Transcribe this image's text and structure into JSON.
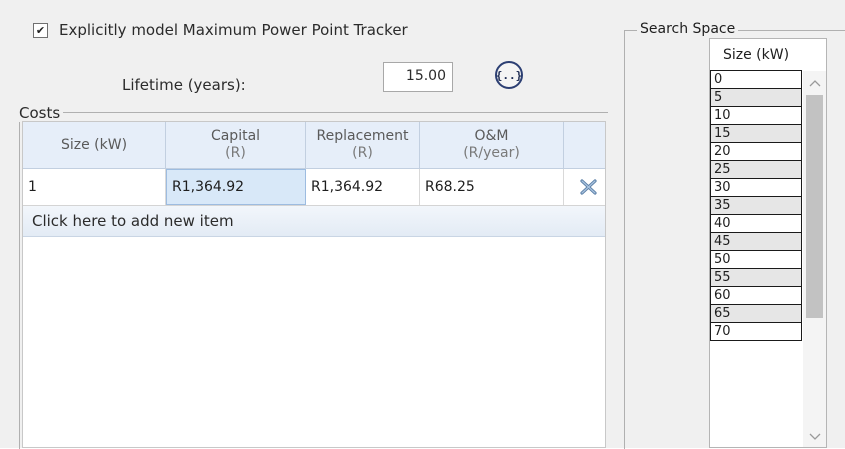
{
  "mppt": {
    "checkbox_mark": "✔",
    "label": "Explicitly model Maximum Power Point Tracker",
    "checked": true
  },
  "lifetime": {
    "label": "Lifetime (years):",
    "value": "15.00",
    "library_button": "{..}"
  },
  "costs": {
    "legend": "Costs",
    "columns": [
      {
        "title": "Size (kW)",
        "unit": ""
      },
      {
        "title": "Capital",
        "unit": "(R)"
      },
      {
        "title": "Replacement",
        "unit": "(R)"
      },
      {
        "title": "O&M",
        "unit": "(R/year)"
      }
    ],
    "rows": [
      {
        "size": "1",
        "capital": "R1,364.92",
        "replacement": "R1,364.92",
        "om": "R68.25"
      }
    ],
    "add_item_text": "Click here to add new item",
    "colors": {
      "header_bg": "#e6eef9",
      "selected_cell": "#d8e8f8"
    }
  },
  "search_space": {
    "legend": "Search Space",
    "column": "Size (kW)",
    "values": [
      "0",
      "5",
      "10",
      "15",
      "20",
      "25",
      "30",
      "35",
      "40",
      "45",
      "50",
      "55",
      "60",
      "65",
      "70"
    ]
  },
  "icons": {
    "delete": "delete-x-icon",
    "scroll_up": "chevron-up-icon",
    "scroll_down": "chevron-down-icon"
  }
}
